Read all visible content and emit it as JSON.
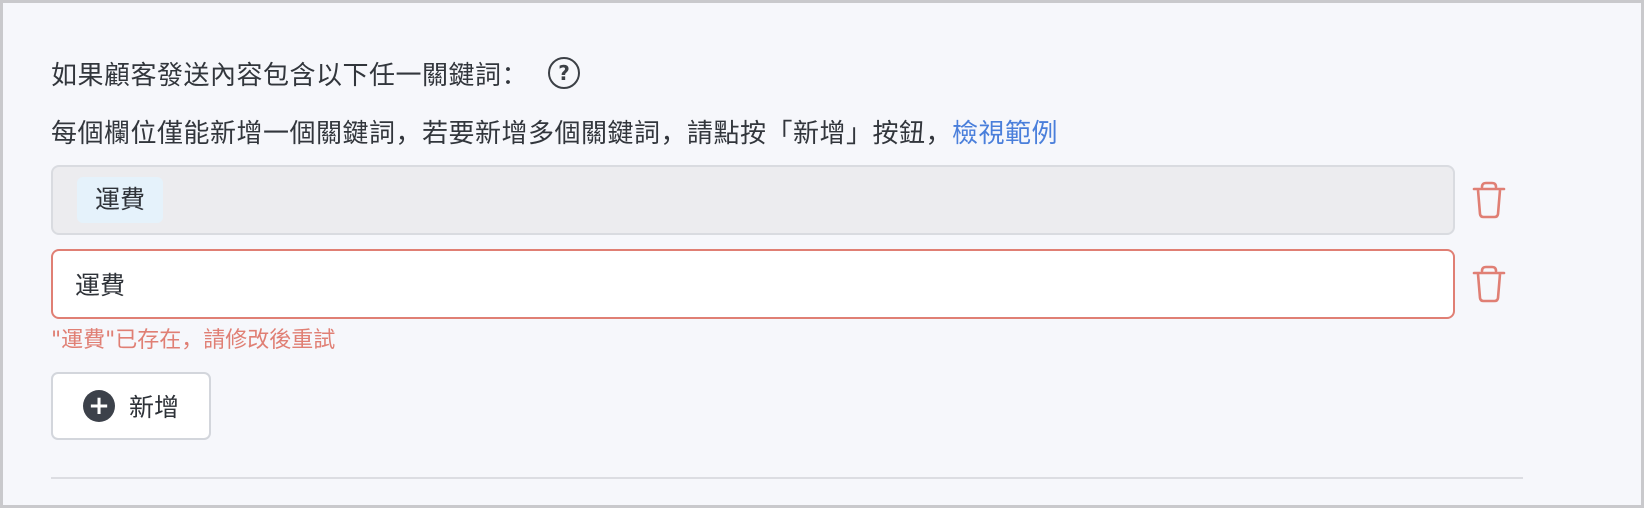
{
  "keyword_section": {
    "heading": "如果顧客發送內容包含以下任一關鍵詞：",
    "help_icon": "question-circle-icon",
    "instruction": "每個欄位僅能新增一個關鍵詞，若要新增多個關鍵詞，請點按「新增」按鈕，",
    "view_example_link": "檢視範例"
  },
  "keyword_fields": [
    {
      "tag": "運費",
      "state": "confirmed",
      "delete_icon": "trash-icon"
    },
    {
      "value": "運費",
      "state": "error",
      "error_message": "\"運費\"已存在，請修改後重試",
      "delete_icon": "trash-icon"
    }
  ],
  "add_button": {
    "icon": "plus-circle-icon",
    "label": "新增"
  },
  "colors": {
    "link": "#4a7fdb",
    "error": "#e07f74",
    "tag_background": "#e5f2fb",
    "confirmed_field_background": "#ececef",
    "page_background": "#f6f7fb",
    "icon_dark": "#3c414a"
  }
}
